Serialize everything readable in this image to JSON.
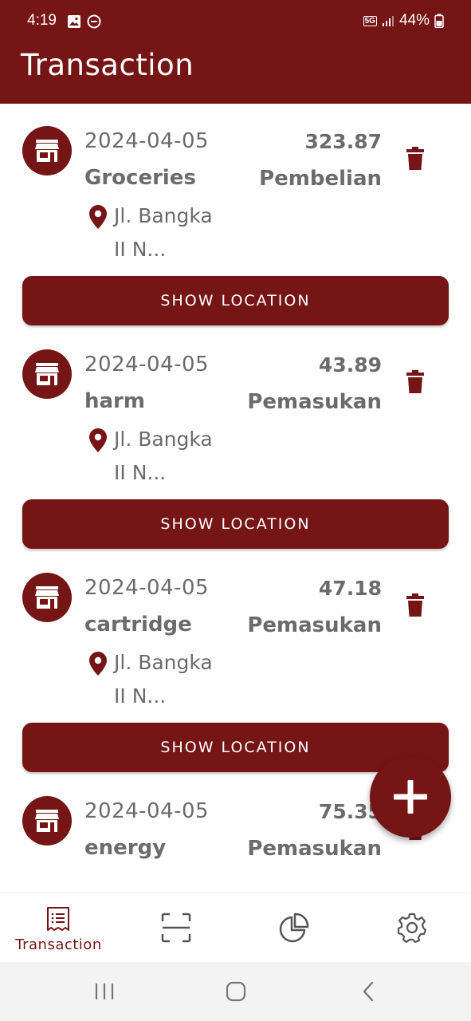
{
  "status_bar": {
    "time": "4:19",
    "network": "5G",
    "battery": "44%"
  },
  "app_bar": {
    "title": "Transaction"
  },
  "transactions": [
    {
      "date": "2024-04-05",
      "name": "Groceries",
      "amount": "323.87",
      "type": "Pembelian",
      "address_line1": "Jl. Bangka",
      "address_line2": "II N...",
      "button_label": "SHOW LOCATION"
    },
    {
      "date": "2024-04-05",
      "name": "harm",
      "amount": "43.89",
      "type": "Pemasukan",
      "address_line1": "Jl. Bangka",
      "address_line2": "II N...",
      "button_label": "SHOW LOCATION"
    },
    {
      "date": "2024-04-05",
      "name": "cartridge",
      "amount": "47.18",
      "type": "Pemasukan",
      "address_line1": "Jl. Bangka",
      "address_line2": "II N...",
      "button_label": "SHOW LOCATION"
    },
    {
      "date": "2024-04-05",
      "name": "energy",
      "amount": "75.35",
      "type": "Pemasukan"
    }
  ],
  "bottom_nav": {
    "items": [
      {
        "label": "Transaction",
        "icon": "receipt-list-icon",
        "active": true
      },
      {
        "label": "",
        "icon": "scan-icon",
        "active": false
      },
      {
        "label": "",
        "icon": "pie-chart-icon",
        "active": false
      },
      {
        "label": "",
        "icon": "gear-icon",
        "active": false
      }
    ]
  },
  "icons": {
    "store": "store-icon",
    "location": "location-pin-icon",
    "delete": "trash-icon",
    "add": "plus-icon"
  },
  "colors": {
    "primary": "#761515",
    "text_secondary": "#6b6b6b",
    "background": "#ffffff"
  }
}
